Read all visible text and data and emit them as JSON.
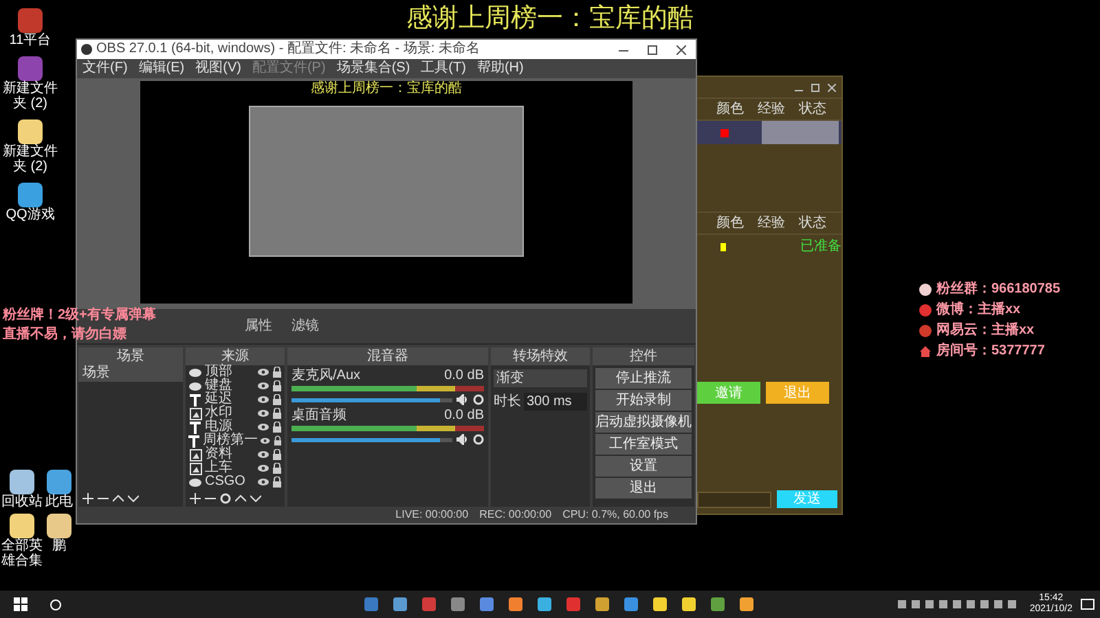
{
  "banner": {
    "title": "感谢上周榜一：宝库的酷"
  },
  "desktop_icons": [
    {
      "kind": "app",
      "label": "11平台"
    },
    {
      "kind": "archive",
      "label": "新建文件夹 (2)"
    },
    {
      "kind": "folder",
      "label": "新建文件夹 (2)"
    },
    {
      "kind": "game",
      "label": "QQ游戏"
    }
  ],
  "desktop_icons_bottom": [
    {
      "kind": "bin",
      "label": "回收站"
    },
    {
      "kind": "pc",
      "label": "此电"
    },
    {
      "kind": "folder",
      "label": "全部英雄合集"
    },
    {
      "kind": "file",
      "label": "鹏"
    }
  ],
  "streamer_overlay": {
    "lines": [
      "粉丝牌！2级+有专属弹幕",
      "直播不易，请勿白嫖"
    ]
  },
  "social_overlay": [
    {
      "kind": "group",
      "text": "粉丝群：966180785"
    },
    {
      "kind": "weibo",
      "text": "微博：主播xx"
    },
    {
      "kind": "music",
      "text": "网易云：主播xx"
    },
    {
      "kind": "home",
      "text": "房间号：5377777"
    }
  ],
  "game_window": {
    "tables": [
      {
        "columns": [
          "颜色",
          "经验",
          "状态"
        ],
        "rows": [
          {
            "color": "#ff0000",
            "banner": true
          }
        ]
      },
      {
        "columns": [
          "颜色",
          "经验",
          "状态"
        ],
        "rows": [
          {
            "color": "#ffff00",
            "status": "已准备"
          }
        ]
      }
    ],
    "buttons": [
      {
        "kind": "green",
        "label": "邀请"
      },
      {
        "kind": "yellow",
        "label": "退出"
      }
    ],
    "send": "发送"
  },
  "obs": {
    "title": "OBS 27.0.1 (64-bit, windows) - 配置文件: 未命名 - 场景: 未命名",
    "menu": [
      {
        "label": "文件(F)",
        "disabled": false
      },
      {
        "label": "编辑(E)",
        "disabled": false
      },
      {
        "label": "视图(V)",
        "disabled": false
      },
      {
        "label": "配置文件(P)",
        "disabled": true
      },
      {
        "label": "场景集合(S)",
        "disabled": false
      },
      {
        "label": "工具(T)",
        "disabled": false
      },
      {
        "label": "帮助(H)",
        "disabled": false
      }
    ],
    "preview": {
      "title": "感谢上周榜一：宝库的酷"
    },
    "toolbar": [
      "属性",
      "滤镜"
    ],
    "scenes": {
      "title": "场景",
      "items": [
        {
          "label": "场景",
          "selected": true
        }
      ]
    },
    "sources": {
      "title": "来源",
      "items": [
        {
          "kind": "capture",
          "label": "顶部"
        },
        {
          "kind": "capture",
          "label": "键盘"
        },
        {
          "kind": "text",
          "label": "延迟"
        },
        {
          "kind": "image",
          "label": "水印"
        },
        {
          "kind": "text",
          "label": "电源"
        },
        {
          "kind": "text",
          "label": "周榜第一"
        },
        {
          "kind": "image",
          "label": "资料"
        },
        {
          "kind": "image",
          "label": "上车"
        },
        {
          "kind": "capture",
          "label": "CSGO"
        }
      ]
    },
    "mixer": {
      "title": "混音器",
      "channels": [
        {
          "name": "麦克风/Aux",
          "reading": "0.0 dB",
          "level": 0.92
        },
        {
          "name": "桌面音频",
          "reading": "0.0 dB",
          "level": 0.92
        }
      ]
    },
    "transitions": {
      "title": "转场特效",
      "effect": "渐变",
      "duration_label": "时长",
      "duration": "300 ms"
    },
    "controls": {
      "title": "控件",
      "buttons": [
        "停止推流",
        "开始录制",
        "启动虚拟摄像机",
        "工作室模式",
        "设置",
        "退出"
      ]
    },
    "status": {
      "live": "LIVE: 00:00:00",
      "rec": "REC: 00:00:00",
      "cpu": "CPU: 0.7%, 60.00 fps"
    }
  },
  "taskbar": {
    "time": "15:42",
    "date": "2021/10/2"
  }
}
